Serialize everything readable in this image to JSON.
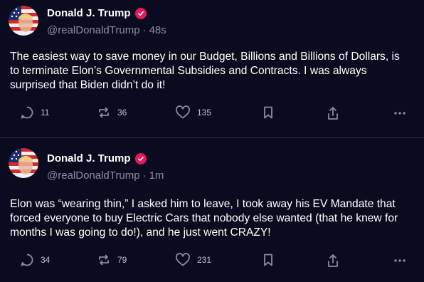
{
  "posts": [
    {
      "author": "Donald J. Trump",
      "handle": "@realDonaldTrump",
      "separator": "·",
      "time": "48s",
      "text": "The easiest way to save money in our Budget, Billions and Billions of Dollars, is to terminate Elon’s Governmental Subsidies and Contracts. I was always surprised that Biden didn’t do it!",
      "replies": "11",
      "reposts": "36",
      "likes": "135"
    },
    {
      "author": "Donald J. Trump",
      "handle": "@realDonaldTrump",
      "separator": "·",
      "time": "1m",
      "text": "Elon was “wearing thin,” I asked him to leave, I took away his EV Mandate that forced everyone to buy Electric Cars that nobody else wanted (that he knew for months I was going to do!), and he just went CRAZY!",
      "replies": "34",
      "reposts": "79",
      "likes": "231"
    }
  ],
  "colors": {
    "background": "#0b0b1f",
    "verified_badge": "#e8195b",
    "muted": "#8b8b9e",
    "divider": "#2a2a3d"
  },
  "icons": [
    "avatar-flag",
    "verified-icon",
    "reply-icon",
    "repost-icon",
    "like-icon",
    "bookmark-icon",
    "share-icon",
    "more-icon"
  ]
}
